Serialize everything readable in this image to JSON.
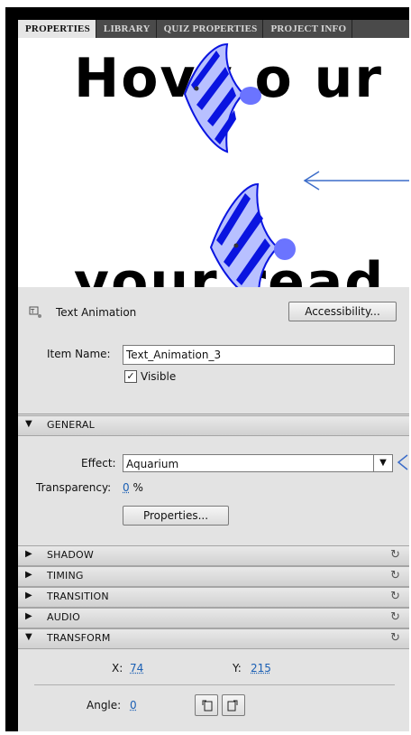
{
  "tabs": [
    "PROPERTIES",
    "LIBRARY",
    "QUIZ PROPERTIES",
    "PROJECT INFO"
  ],
  "preview": {
    "line1": "Hovv o ur",
    "line2": "your read"
  },
  "object": {
    "type_label": "Text Animation",
    "accessibility_label": "Accessibility...",
    "item_name_label": "Item Name:",
    "item_name_value": "Text_Animation_3",
    "visible_label": "Visible",
    "visible_checked": true
  },
  "general": {
    "header": "GENERAL",
    "effect_label": "Effect:",
    "effect_value": "Aquarium",
    "transparency_label": "Transparency:",
    "transparency_value": "0",
    "transparency_unit": "%",
    "properties_button": "Properties..."
  },
  "sections": {
    "shadow": "SHADOW",
    "timing": "TIMING",
    "transition": "TRANSITION",
    "audio": "AUDIO",
    "transform": "TRANSFORM"
  },
  "transform": {
    "x_label": "X:",
    "x_value": "74",
    "y_label": "Y:",
    "y_value": "215",
    "angle_label": "Angle:",
    "angle_value": "0"
  },
  "colors": {
    "fish_blue": "#0a14e0",
    "fish_light": "#b8c0ff",
    "arrow_blue": "#3b6cc9"
  }
}
